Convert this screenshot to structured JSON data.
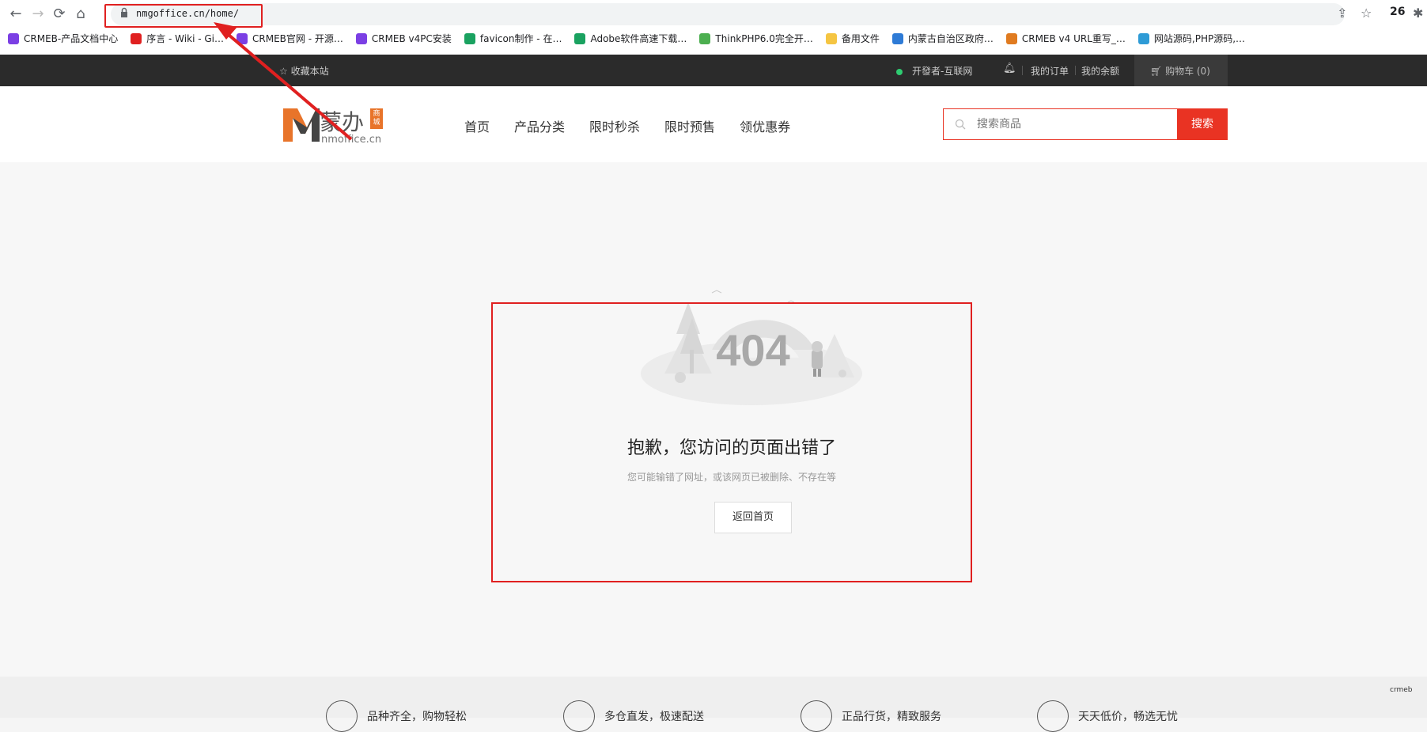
{
  "browser": {
    "url": "nmgoffice.cn/home/",
    "counter": "26",
    "bookmarks": [
      {
        "label": "CRMEB-产品文档中心",
        "icon": "crmeb-c-icon",
        "color": "#7b3fe4"
      },
      {
        "label": "序言 - Wiki - Gi…",
        "icon": "wiki-icon",
        "color": "#e02020"
      },
      {
        "label": "CRMEB官网 - 开源…",
        "icon": "crmeb-c-icon",
        "color": "#7b3fe4"
      },
      {
        "label": "CRMEB v4PC安装",
        "icon": "crmeb-c-icon",
        "color": "#7b3fe4"
      },
      {
        "label": "favicon制作 - 在…",
        "icon": "favicon-t-icon",
        "color": "#1aa260"
      },
      {
        "label": "Adobe软件高速下载…",
        "icon": "adobe-icon",
        "color": "#1aa260"
      },
      {
        "label": "ThinkPHP6.0完全开…",
        "icon": "thinkphp-icon",
        "color": "#4caf50"
      },
      {
        "label": "备用文件",
        "icon": "folder-icon",
        "color": "#f5c542"
      },
      {
        "label": "内蒙古自治区政府…",
        "icon": "gov-icon",
        "color": "#2e7bd6"
      },
      {
        "label": "CRMEB v4 URL重写_…",
        "icon": "crmeb-hex-icon",
        "color": "#e07b20"
      },
      {
        "label": "网站源码,PHP源码,…",
        "icon": "cloud-icon",
        "color": "#2e9bd6"
      }
    ]
  },
  "topbar": {
    "favorite": "收藏本站",
    "developer": "开發者-互联网",
    "orders": "我的订单",
    "balance": "我的余额",
    "cart": "购物车 (0)"
  },
  "header": {
    "logo_text": "蒙办",
    "logo_badge": "商城",
    "logo_domain": "nmoffice.cn",
    "menu": [
      "首页",
      "产品分类",
      "限时秒杀",
      "限时预售",
      "领优惠券"
    ],
    "search_placeholder": "搜索商品",
    "search_button": "搜索"
  },
  "error": {
    "code": "404",
    "title": "抱歉，您访问的页面出错了",
    "subtitle": "您可能输错了网址，或该网页已被删除、不存在等",
    "back_button": "返回首页"
  },
  "footer": {
    "features": [
      "品种齐全，购物轻松",
      "多仓直发，极速配送",
      "正品行货，精致服务",
      "天天低价，畅选无忧"
    ],
    "corner": "crmeb"
  }
}
